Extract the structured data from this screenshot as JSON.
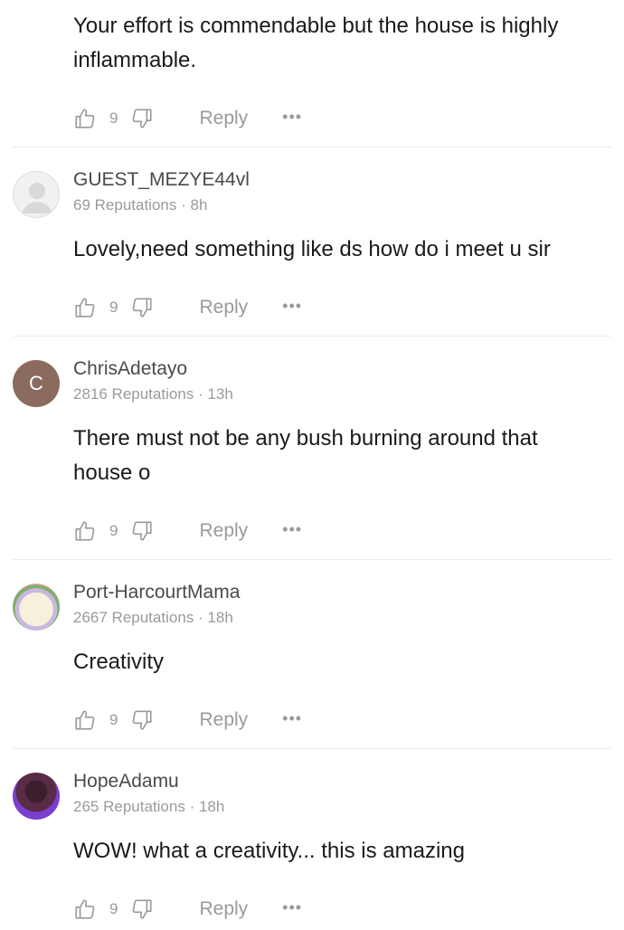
{
  "comments": [
    {
      "username": "",
      "reputation": "",
      "time": "",
      "text": "Your effort is commendable but the house is highly inflammable.",
      "likes": "9",
      "reply_label": "Reply",
      "more": "•••"
    },
    {
      "username": "GUEST_MEZYE44vl",
      "reputation": "69 Reputations",
      "time": "8h",
      "text": "Lovely,need something like ds how do i meet u sir",
      "likes": "9",
      "reply_label": "Reply",
      "more": "•••"
    },
    {
      "username": "ChrisAdetayo",
      "avatar_letter": "C",
      "reputation": "2816 Reputations",
      "time": "13h",
      "text": "There must not be any bush burning around that house o",
      "likes": "9",
      "reply_label": "Reply",
      "more": "•••"
    },
    {
      "username": "Port-HarcourtMama",
      "reputation": "2667 Reputations",
      "time": "18h",
      "text": "Creativity",
      "likes": "9",
      "reply_label": "Reply",
      "more": "•••"
    },
    {
      "username": "HopeAdamu",
      "reputation": "265 Reputations",
      "time": "18h",
      "text": "WOW! what a creativity... this is amazing",
      "likes": "9",
      "reply_label": "Reply",
      "more": "•••"
    }
  ],
  "meta_separator": "·",
  "colors": {
    "text_primary": "#1a1a1a",
    "text_secondary": "#9a9a9a",
    "divider": "#ececec",
    "avatar_letter_bg": "#8b6b5e"
  },
  "icons": [
    "thumbs-up-icon",
    "thumbs-down-icon",
    "more-dots-icon",
    "default-avatar-icon"
  ]
}
